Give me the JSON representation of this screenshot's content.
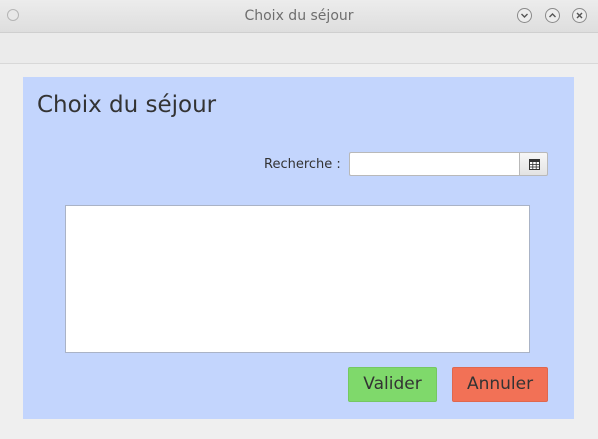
{
  "window": {
    "title": "Choix du séjour"
  },
  "panel": {
    "heading": "Choix du séjour",
    "search_label": "Recherche :",
    "search_value": "",
    "search_placeholder": "",
    "search_button_icon": "calendar-grid-icon",
    "list_items": []
  },
  "buttons": {
    "validate_label": "Valider",
    "cancel_label": "Annuler"
  },
  "colors": {
    "panel_background": "#c3d5fd",
    "validate_button": "#7fd96b",
    "cancel_button": "#f27156"
  }
}
